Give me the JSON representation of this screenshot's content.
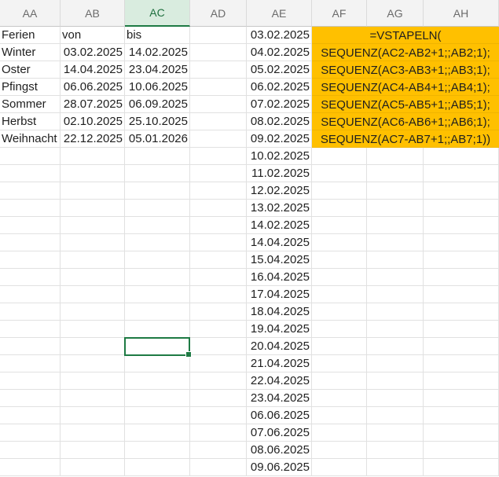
{
  "columns": [
    "AA",
    "AB",
    "AC",
    "AD",
    "AE",
    "AF",
    "AG",
    "AH"
  ],
  "active_column": "AC",
  "holidays": {
    "headers": [
      "Ferien",
      "von",
      "bis"
    ],
    "rows": [
      [
        "Winter",
        "03.02.2025",
        "14.02.2025"
      ],
      [
        "Oster",
        "14.04.2025",
        "23.04.2025"
      ],
      [
        "Pfingst",
        "06.06.2025",
        "10.06.2025"
      ],
      [
        "Sommer",
        "28.07.2025",
        "06.09.2025"
      ],
      [
        "Herbst",
        "02.10.2025",
        "25.10.2025"
      ],
      [
        "Weihnacht",
        "22.12.2025",
        "05.01.2026"
      ]
    ]
  },
  "ae_dates": [
    "03.02.2025",
    "04.02.2025",
    "05.02.2025",
    "06.02.2025",
    "07.02.2025",
    "08.02.2025",
    "09.02.2025",
    "10.02.2025",
    "11.02.2025",
    "12.02.2025",
    "13.02.2025",
    "14.02.2025",
    "14.04.2025",
    "15.04.2025",
    "16.04.2025",
    "17.04.2025",
    "18.04.2025",
    "19.04.2025",
    "20.04.2025",
    "21.04.2025",
    "22.04.2025",
    "23.04.2025",
    "06.06.2025",
    "07.06.2025",
    "08.06.2025",
    "09.06.2025"
  ],
  "formula_lines": [
    "=VSTAPELN(",
    "SEQUENZ(AC2-AB2+1;;AB2;1);",
    "SEQUENZ(AC3-AB3+1;;AB3;1);",
    "SEQUENZ(AC4-AB4+1;;AB4;1);",
    "SEQUENZ(AC5-AB5+1;;AB5;1);",
    "SEQUENZ(AC6-AB6+1;;AB6;1);",
    "SEQUENZ(AC7-AB7+1;;AB7;1))"
  ],
  "highlight_color": "#ffc000",
  "selection_color": "#1e7a44",
  "selected_cell": "AC19"
}
